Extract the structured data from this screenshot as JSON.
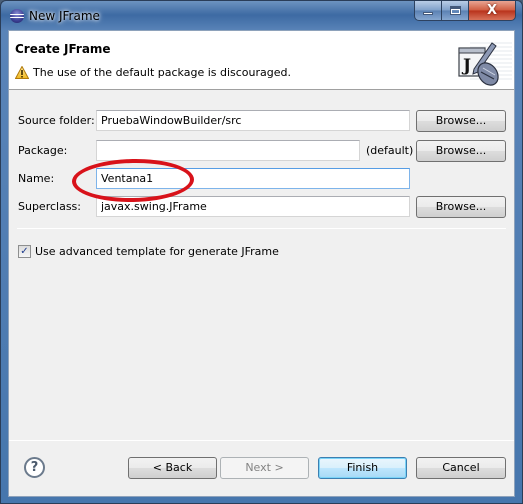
{
  "window": {
    "title": "New JFrame",
    "controls": {
      "minimize": "minimize-icon",
      "maximize": "maximize-icon",
      "close": "close-icon"
    }
  },
  "header": {
    "title": "Create JFrame",
    "message": "The use of the default package is discouraged.",
    "message_icon": "warning-icon",
    "banner_icon": "jframe-wizard-icon"
  },
  "form": {
    "source_folder": {
      "label": "Source folder:",
      "value": "PruebaWindowBuilder/src",
      "browse_label": "Browse..."
    },
    "package": {
      "label": "Package:",
      "value": "",
      "suffix": "(default)",
      "browse_label": "Browse..."
    },
    "name": {
      "label": "Name:",
      "value": "Ventana1"
    },
    "superclass": {
      "label": "Superclass:",
      "value": "javax.swing.JFrame",
      "browse_label": "Browse..."
    },
    "advanced_template": {
      "label": "Use advanced template for generate JFrame",
      "checked": true
    }
  },
  "annotation": {
    "color": "#d8121a",
    "target": "name-field"
  },
  "footer": {
    "help_icon": "help-icon",
    "back_label": "< Back",
    "next_label": "Next >",
    "finish_label": "Finish",
    "cancel_label": "Cancel"
  }
}
